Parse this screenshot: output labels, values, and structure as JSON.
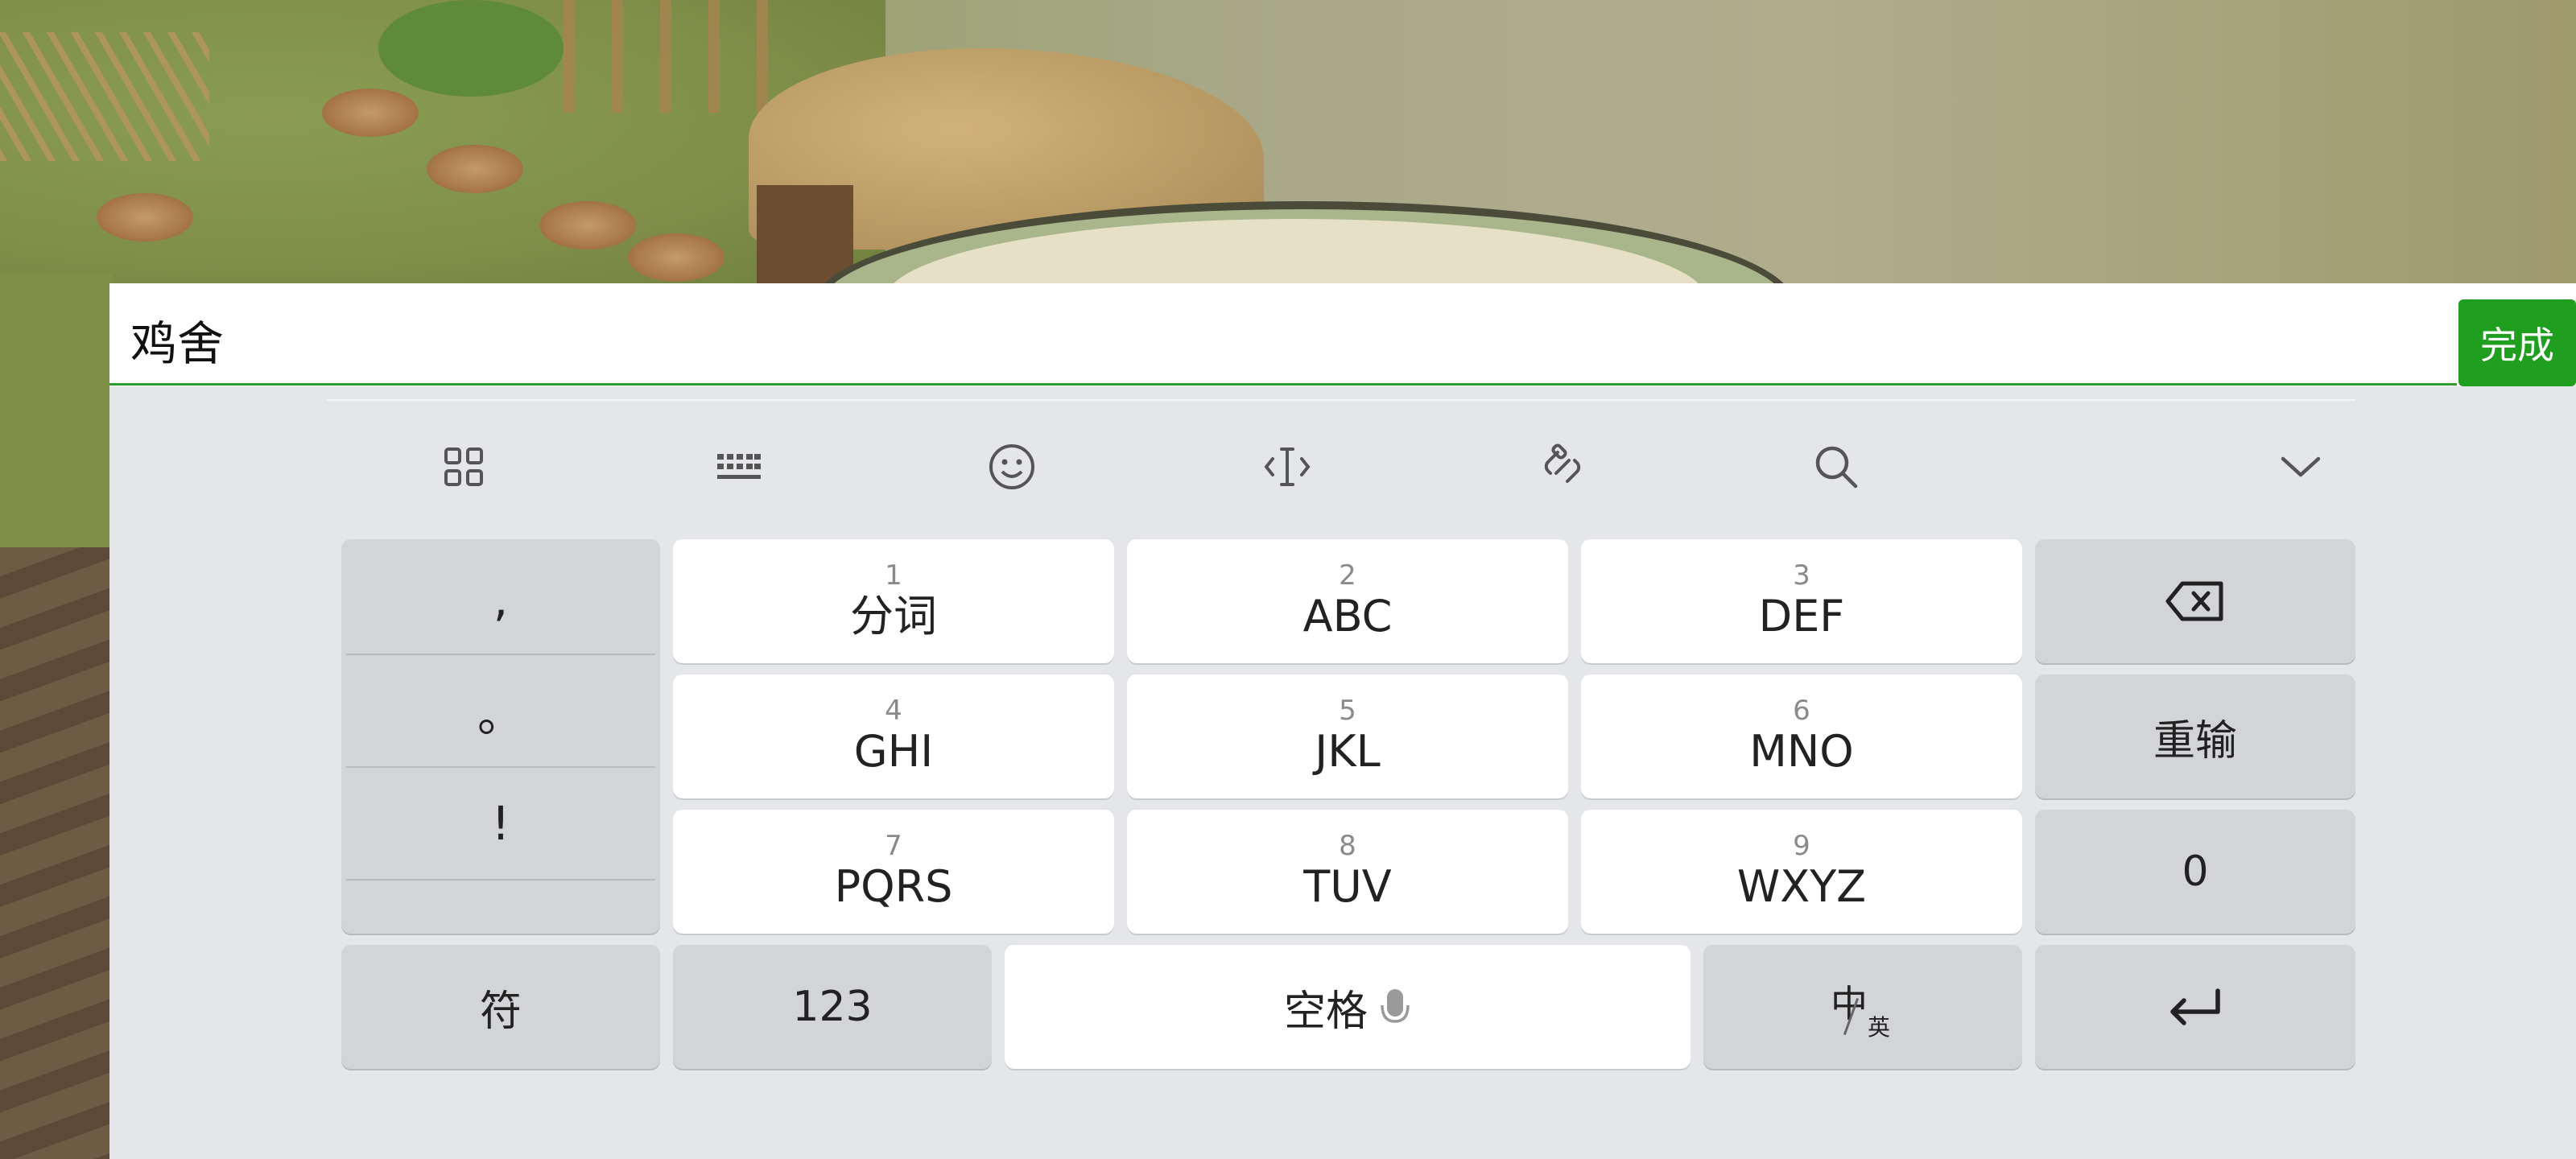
{
  "input": {
    "value": "鸡舍",
    "done_label": "完成"
  },
  "toolbar": {
    "items": [
      "apps-grid-icon",
      "keyboard-icon",
      "emoji-icon",
      "cursor-move-icon",
      "clipboard-link-icon",
      "search-icon",
      "collapse-chevron-icon"
    ]
  },
  "keyboard": {
    "punctuation": [
      ",",
      "。",
      "!"
    ],
    "keys": [
      {
        "num": "1",
        "letters": "分词"
      },
      {
        "num": "2",
        "letters": "ABC"
      },
      {
        "num": "3",
        "letters": "DEF"
      },
      {
        "num": "4",
        "letters": "GHI"
      },
      {
        "num": "5",
        "letters": "JKL"
      },
      {
        "num": "6",
        "letters": "MNO"
      },
      {
        "num": "7",
        "letters": "PQRS"
      },
      {
        "num": "8",
        "letters": "TUV"
      },
      {
        "num": "9",
        "letters": "WXYZ"
      }
    ],
    "backspace_icon": "backspace-icon",
    "reenter_label": "重输",
    "zero_label": "0",
    "symbol_label": "符",
    "numbers_label": "123",
    "space_label": "空格",
    "lang_main": "中",
    "lang_sub": "英",
    "enter_icon": "enter-icon"
  },
  "colors": {
    "accent": "#1f9e1f",
    "keyboard_bg": "#e4e6ea",
    "key_gray": "#d2d4d8"
  }
}
